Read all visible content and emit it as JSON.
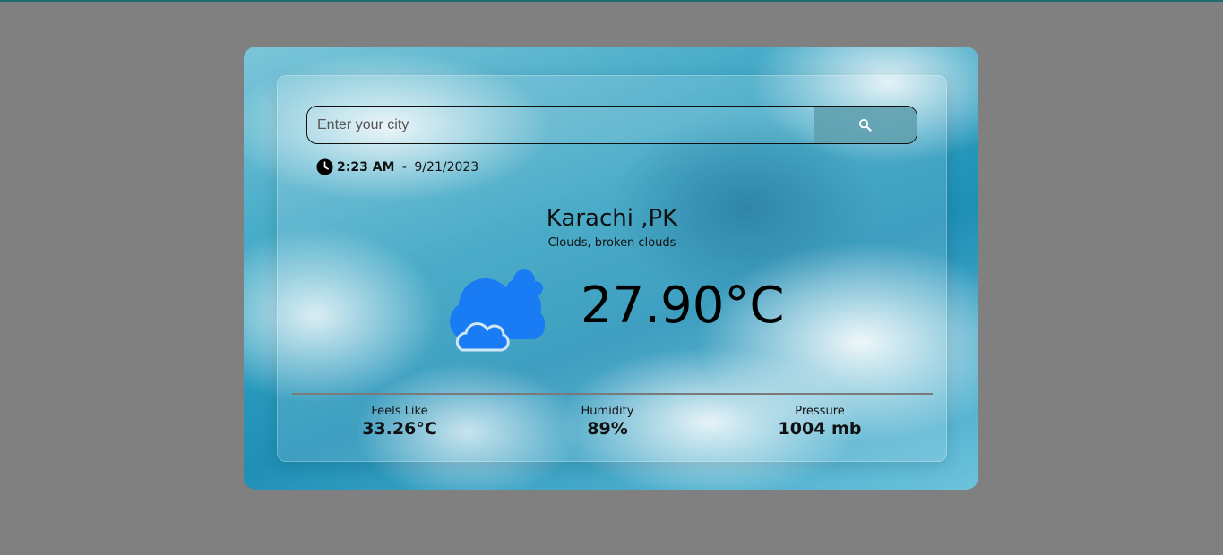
{
  "search": {
    "placeholder": "Enter your city",
    "button_icon": "search-icon"
  },
  "datetime": {
    "clock_icon": "clock-icon",
    "time": "2:23 AM",
    "separator": " - ",
    "date": "9/21/2023"
  },
  "location": {
    "city": "Karachi ,PK",
    "description": "Clouds, broken clouds"
  },
  "current": {
    "icon": "clouds-icon",
    "icon_color": "#1a7cf5",
    "temperature": "27.90°C"
  },
  "stats": [
    {
      "label": "Feels Like",
      "value": "33.26°C"
    },
    {
      "label": "Humidity",
      "value": "89%"
    },
    {
      "label": "Pressure",
      "value": "1004 mb"
    }
  ]
}
